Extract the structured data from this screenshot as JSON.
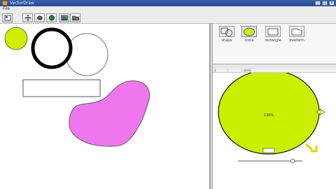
{
  "window": {
    "title": "VectorDraw"
  },
  "menu": {
    "file": "File"
  },
  "toolbar": {
    "buttons": [
      {
        "icon": "select-tool-icon"
      },
      {
        "icon": "move-tool-icon"
      },
      {
        "icon": "shape-tool-icon"
      },
      {
        "icon": "circle-tool-icon"
      },
      {
        "icon": "image-tool-icon"
      },
      {
        "icon": "folder-tool-icon"
      }
    ]
  },
  "palette": {
    "items": [
      {
        "label": "shape",
        "icon": "shape-icon"
      },
      {
        "label": "circle",
        "icon": "circle-icon",
        "selected": true
      },
      {
        "label": "rectangle",
        "icon": "rectangle-icon"
      },
      {
        "label": "freeform",
        "icon": "freeform-icon"
      }
    ]
  },
  "inspector": {
    "columns": [
      "1",
      "",
      "circle"
    ],
    "zoom_label": "130%",
    "slider_value": 0.85,
    "colors": {
      "circle_fill": "#ccee00",
      "handle": "#e6d200"
    }
  },
  "canvas": {
    "colors": {
      "lime": "#ccee00",
      "pink": "#ee77ee",
      "outline": "#000000"
    }
  }
}
